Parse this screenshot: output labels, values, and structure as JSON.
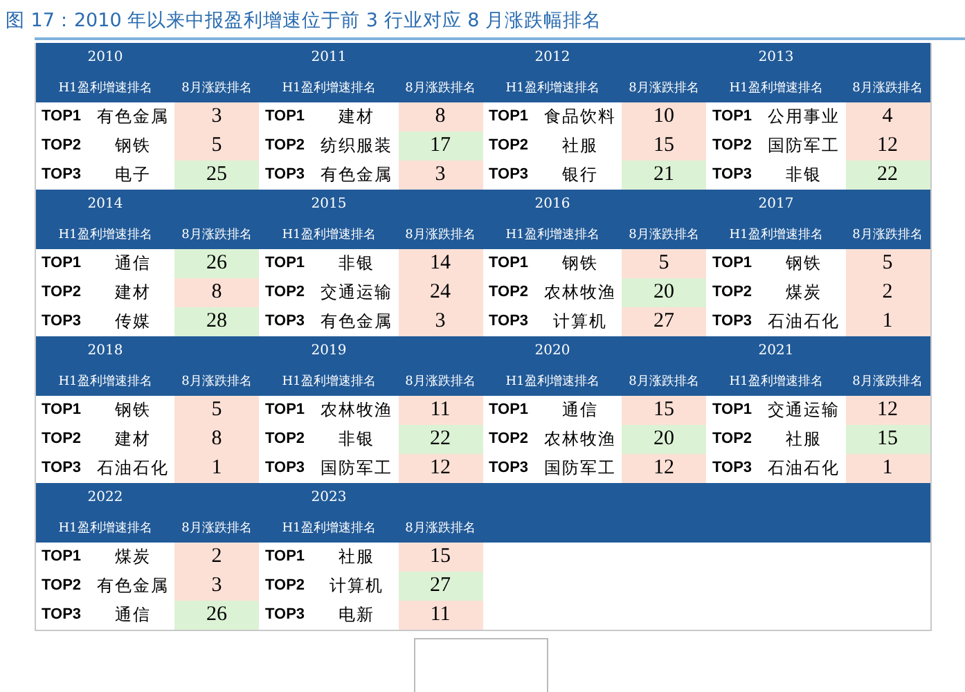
{
  "title": "图 17：2010 年以来中报盈利增速位于前 3 行业对应 8 月涨跌幅排名",
  "blocks": [
    {
      "year": "2010",
      "name_header": "H1盈利增速排名",
      "rank_header": "8月涨跌排名",
      "rows": [
        {
          "label": "TOP1",
          "name": "有色金属",
          "rank": "3",
          "color": "#fce0d6"
        },
        {
          "label": "TOP2",
          "name": "钢铁",
          "rank": "5",
          "color": "#fce0d6"
        },
        {
          "label": "TOP3",
          "name": "电子",
          "rank": "25",
          "color": "#dcf2d5"
        }
      ]
    },
    {
      "year": "2011",
      "name_header": "H1盈利增速排名",
      "rank_header": "8月涨跌排名",
      "rows": [
        {
          "label": "TOP1",
          "name": "建材",
          "rank": "8",
          "color": "#fce0d6"
        },
        {
          "label": "TOP2",
          "name": "纺织服装",
          "rank": "17",
          "color": "#dcf2d5"
        },
        {
          "label": "TOP3",
          "name": "有色金属",
          "rank": "3",
          "color": "#fce0d6"
        }
      ]
    },
    {
      "year": "2012",
      "name_header": "H1盈利增速排名",
      "rank_header": "8月涨跌排名",
      "rows": [
        {
          "label": "TOP1",
          "name": "食品饮料",
          "rank": "10",
          "color": "#fce0d6"
        },
        {
          "label": "TOP2",
          "name": "社服",
          "rank": "15",
          "color": "#fce0d6"
        },
        {
          "label": "TOP3",
          "name": "银行",
          "rank": "21",
          "color": "#dcf2d5"
        }
      ]
    },
    {
      "year": "2013",
      "name_header": "H1盈利增速排名",
      "rank_header": "8月涨跌排名",
      "rows": [
        {
          "label": "TOP1",
          "name": "公用事业",
          "rank": "4",
          "color": "#fce0d6"
        },
        {
          "label": "TOP2",
          "name": "国防军工",
          "rank": "12",
          "color": "#fce0d6"
        },
        {
          "label": "TOP3",
          "name": "非银",
          "rank": "22",
          "color": "#dcf2d5"
        }
      ]
    },
    {
      "year": "2014",
      "name_header": "H1盈利增速排名",
      "rank_header": "8月涨跌排名",
      "rows": [
        {
          "label": "TOP1",
          "name": "通信",
          "rank": "26",
          "color": "#dcf2d5"
        },
        {
          "label": "TOP2",
          "name": "建材",
          "rank": "8",
          "color": "#fce0d6"
        },
        {
          "label": "TOP3",
          "name": "传媒",
          "rank": "28",
          "color": "#dcf2d5"
        }
      ]
    },
    {
      "year": "2015",
      "name_header": "H1盈利增速排名",
      "rank_header": "8月涨跌排名",
      "rows": [
        {
          "label": "TOP1",
          "name": "非银",
          "rank": "14",
          "color": "#fce0d6"
        },
        {
          "label": "TOP2",
          "name": "交通运输",
          "rank": "24",
          "color": "#fce0d6"
        },
        {
          "label": "TOP3",
          "name": "有色金属",
          "rank": "3",
          "color": "#fce0d6"
        }
      ]
    },
    {
      "year": "2016",
      "name_header": "H1盈利增速排名",
      "rank_header": "8月涨跌排名",
      "rows": [
        {
          "label": "TOP1",
          "name": "钢铁",
          "rank": "5",
          "color": "#fce0d6"
        },
        {
          "label": "TOP2",
          "name": "农林牧渔",
          "rank": "20",
          "color": "#dcf2d5"
        },
        {
          "label": "TOP3",
          "name": "计算机",
          "rank": "27",
          "color": "#fce0d6"
        }
      ]
    },
    {
      "year": "2017",
      "name_header": "H1盈利增速排名",
      "rank_header": "8月涨跌排名",
      "rows": [
        {
          "label": "TOP1",
          "name": "钢铁",
          "rank": "5",
          "color": "#fce0d6"
        },
        {
          "label": "TOP2",
          "name": "煤炭",
          "rank": "2",
          "color": "#fce0d6"
        },
        {
          "label": "TOP3",
          "name": "石油石化",
          "rank": "1",
          "color": "#fce0d6"
        }
      ]
    },
    {
      "year": "2018",
      "name_header": "H1盈利增速排名",
      "rank_header": "8月涨跌排名",
      "rows": [
        {
          "label": "TOP1",
          "name": "钢铁",
          "rank": "5",
          "color": "#fce0d6"
        },
        {
          "label": "TOP2",
          "name": "建材",
          "rank": "8",
          "color": "#fce0d6"
        },
        {
          "label": "TOP3",
          "name": "石油石化",
          "rank": "1",
          "color": "#fce0d6"
        }
      ]
    },
    {
      "year": "2019",
      "name_header": "H1盈利增速排名",
      "rank_header": "8月涨跌排名",
      "rows": [
        {
          "label": "TOP1",
          "name": "农林牧渔",
          "rank": "11",
          "color": "#fce0d6"
        },
        {
          "label": "TOP2",
          "name": "非银",
          "rank": "22",
          "color": "#dcf2d5"
        },
        {
          "label": "TOP3",
          "name": "国防军工",
          "rank": "12",
          "color": "#fce0d6"
        }
      ]
    },
    {
      "year": "2020",
      "name_header": "H1盈利增速排名",
      "rank_header": "8月涨跌排名",
      "rows": [
        {
          "label": "TOP1",
          "name": "通信",
          "rank": "15",
          "color": "#fce0d6"
        },
        {
          "label": "TOP2",
          "name": "农林牧渔",
          "rank": "20",
          "color": "#dcf2d5"
        },
        {
          "label": "TOP3",
          "name": "国防军工",
          "rank": "12",
          "color": "#fce0d6"
        }
      ]
    },
    {
      "year": "2021",
      "name_header": "H1盈利增速排名",
      "rank_header": "8月涨跌排名",
      "rows": [
        {
          "label": "TOP1",
          "name": "交通运输",
          "rank": "12",
          "color": "#fce0d6"
        },
        {
          "label": "TOP2",
          "name": "社服",
          "rank": "15",
          "color": "#dcf2d5"
        },
        {
          "label": "TOP3",
          "name": "石油石化",
          "rank": "1",
          "color": "#fce0d6"
        }
      ]
    },
    {
      "year": "2022",
      "name_header": "H1盈利增速排名",
      "rank_header": "8月涨跌排名",
      "rows": [
        {
          "label": "TOP1",
          "name": "煤炭",
          "rank": "2",
          "color": "#fce0d6"
        },
        {
          "label": "TOP2",
          "name": "有色金属",
          "rank": "3",
          "color": "#fce0d6"
        },
        {
          "label": "TOP3",
          "name": "通信",
          "rank": "26",
          "color": "#dcf2d5"
        }
      ]
    },
    {
      "year": "2023",
      "name_header": "H1盈利增速排名",
      "rank_header": "8月涨跌排名",
      "rows": [
        {
          "label": "TOP1",
          "name": "社服",
          "rank": "15",
          "color": "#fce0d6"
        },
        {
          "label": "TOP2",
          "name": "计算机",
          "rank": "27",
          "color": "#dcf2d5"
        },
        {
          "label": "TOP3",
          "name": "电新",
          "rank": "11",
          "color": "#fce0d6"
        }
      ]
    }
  ]
}
